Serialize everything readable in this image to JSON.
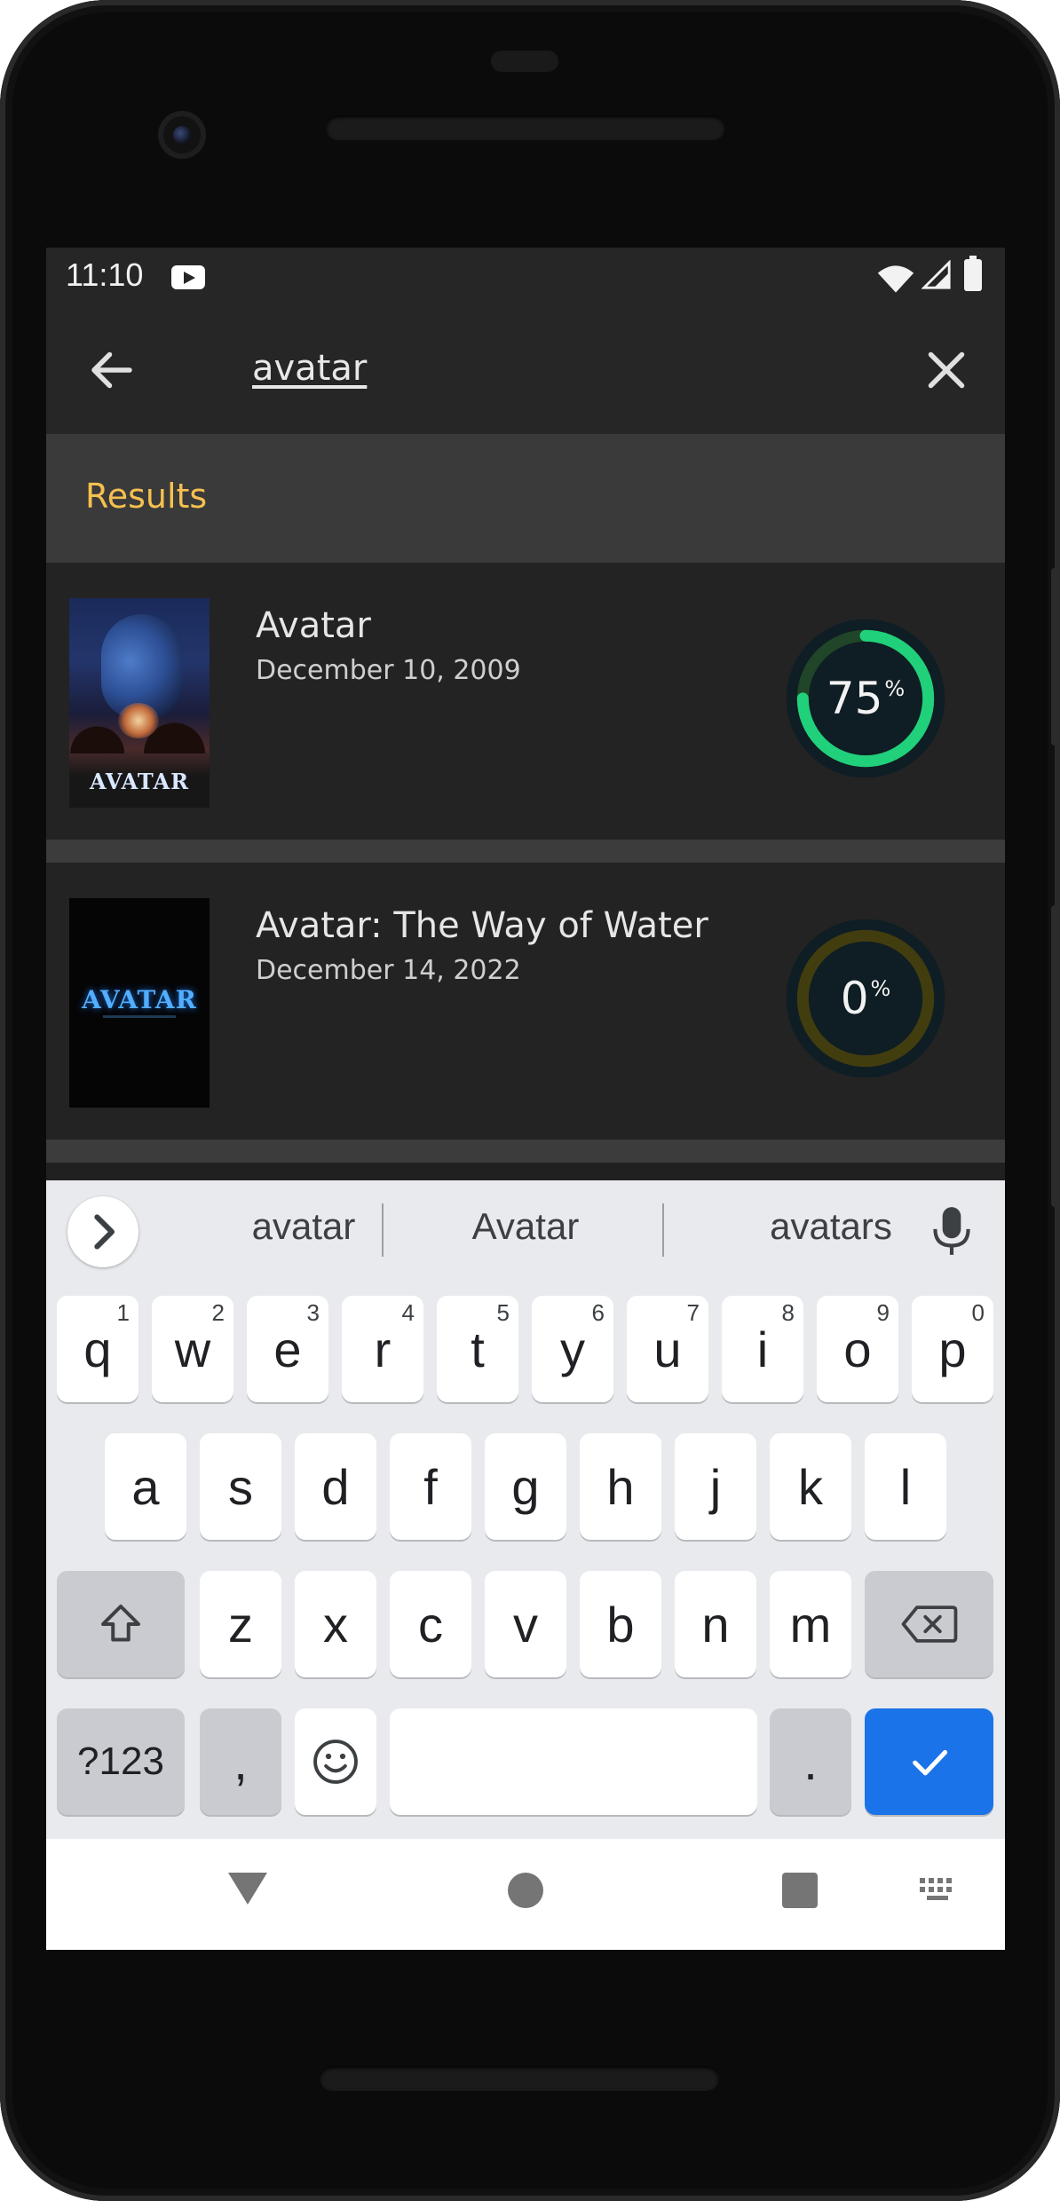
{
  "status_bar": {
    "time": "11:10",
    "icons": [
      "youtube-icon",
      "wifi-icon",
      "signal-icon",
      "battery-icon"
    ]
  },
  "search": {
    "query": "avatar",
    "back_icon": "arrow-left-icon",
    "clear_icon": "close-icon"
  },
  "results": {
    "title": "Results",
    "items": [
      {
        "title": "Avatar",
        "date": "December 10, 2009",
        "poster_text": "AVATAR",
        "score": 75,
        "score_label": "75",
        "score_unit": "%",
        "ring_color": "#21d07a",
        "track_color": "#204529"
      },
      {
        "title": "Avatar: The Way of Water",
        "date": "December 14, 2022",
        "poster_text": "AVATAR",
        "score": 0,
        "score_label": "0",
        "score_unit": "%",
        "ring_color": "#d2d531",
        "track_color": "#423d0f"
      }
    ]
  },
  "keyboard": {
    "suggestions": [
      "avatar",
      "Avatar",
      "avatars"
    ],
    "row1": [
      {
        "key": "q",
        "hint": "1"
      },
      {
        "key": "w",
        "hint": "2"
      },
      {
        "key": "e",
        "hint": "3"
      },
      {
        "key": "r",
        "hint": "4"
      },
      {
        "key": "t",
        "hint": "5"
      },
      {
        "key": "y",
        "hint": "6"
      },
      {
        "key": "u",
        "hint": "7"
      },
      {
        "key": "i",
        "hint": "8"
      },
      {
        "key": "o",
        "hint": "9"
      },
      {
        "key": "p",
        "hint": "0"
      }
    ],
    "row2": [
      "a",
      "s",
      "d",
      "f",
      "g",
      "h",
      "j",
      "k",
      "l"
    ],
    "row3": [
      "z",
      "x",
      "c",
      "v",
      "b",
      "n",
      "m"
    ],
    "symbols_label": "?123",
    "comma_label": ",",
    "period_label": "."
  },
  "colors": {
    "accent": "#f5c04f",
    "enter_key": "#1a73e8",
    "background": "#202020"
  }
}
